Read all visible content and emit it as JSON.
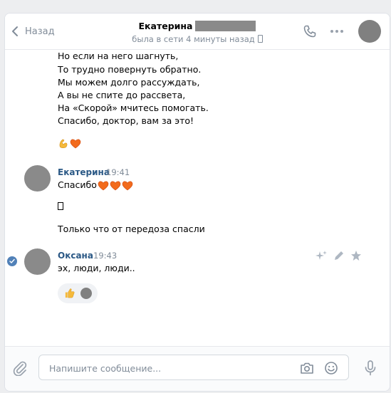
{
  "header": {
    "back_label": "Назад",
    "contact_name": "Екатерина",
    "status": "была в сети 4 минуты назад"
  },
  "messages": {
    "poem_lines": [
      "Но если на него шагнуть,",
      "То трудно повернуть обратно.",
      "Мы можем долго рассуждать,",
      "А вы не спите до рассвета,",
      "На «Скорой» мчитесь помогать.",
      "Спасибо, доктор, вам за это!"
    ],
    "m2_author": "Екатерина",
    "m2_time": "19:41",
    "m2_text": "Спасибо",
    "m2_text2": "Только что от передоза спасли",
    "m3_author": "Оксана",
    "m3_time": "19:43",
    "m3_text": "эх, люди, люди.."
  },
  "composer": {
    "placeholder": "Напишите сообщение..."
  },
  "colors": {
    "accent": "#2a5885",
    "meta": "#818c99",
    "avatar": "#8a8a8a",
    "check": "#5181b8"
  },
  "icons": [
    "chevron-left-icon",
    "phone-icon",
    "more-icon",
    "muscle-icon",
    "heart-icon",
    "check-icon",
    "sparkle-icon",
    "pencil-icon",
    "star-icon",
    "thumbs-up-icon",
    "paperclip-icon",
    "camera-icon",
    "smile-icon",
    "microphone-icon"
  ]
}
